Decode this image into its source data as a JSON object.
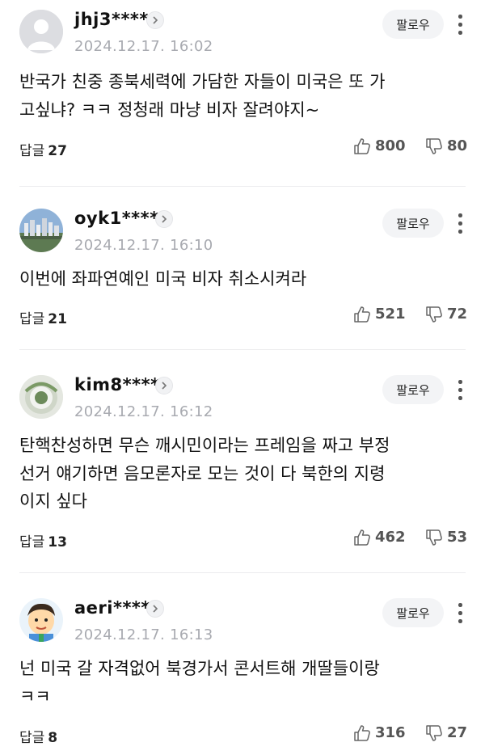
{
  "follow_label": "팔로우",
  "reply_prefix": "답글",
  "comments": [
    {
      "username": "jhj3****",
      "timestamp": "2024.12.17. 16:02",
      "lines": [
        "반국가 친중 종북세력에 가담한 자들이 미국은 또 가",
        "고싶냐? ㅋㅋ 정청래 마냥 비자 잘려야지~"
      ],
      "replies": "27",
      "likes": "800",
      "dislikes": "80",
      "avatar": "default-avatar-icon"
    },
    {
      "username": "oyk1****",
      "timestamp": "2024.12.17. 16:10",
      "lines": [
        "이번에 좌파연예인 미국 비자 취소시켜라"
      ],
      "replies": "21",
      "likes": "521",
      "dislikes": "72",
      "avatar": "city-skyline-avatar"
    },
    {
      "username": "kim8****",
      "timestamp": "2024.12.17. 16:12",
      "lines": [
        "탄핵찬성하면 무슨 깨시민이라는 프레임을 짜고 부정",
        "선거 얘기하면 음모론자로 모는 것이 다 북한의 지령",
        "이지 싶다"
      ],
      "replies": "13",
      "likes": "462",
      "dislikes": "53",
      "avatar": "wreath-avatar"
    },
    {
      "username": "aeri****",
      "timestamp": "2024.12.17. 16:13",
      "lines": [
        "넌 미국 갈 자격없어 북경가서 콘서트해 개딸들이랑",
        "ㅋㅋ"
      ],
      "replies": "8",
      "likes": "316",
      "dislikes": "27",
      "avatar": "cartoon-boy-avatar"
    }
  ],
  "colors": {
    "timestamp": "#a8aab0",
    "follow_bg": "#f3f4f6",
    "divider": "#ececee",
    "vote": "#555555"
  }
}
